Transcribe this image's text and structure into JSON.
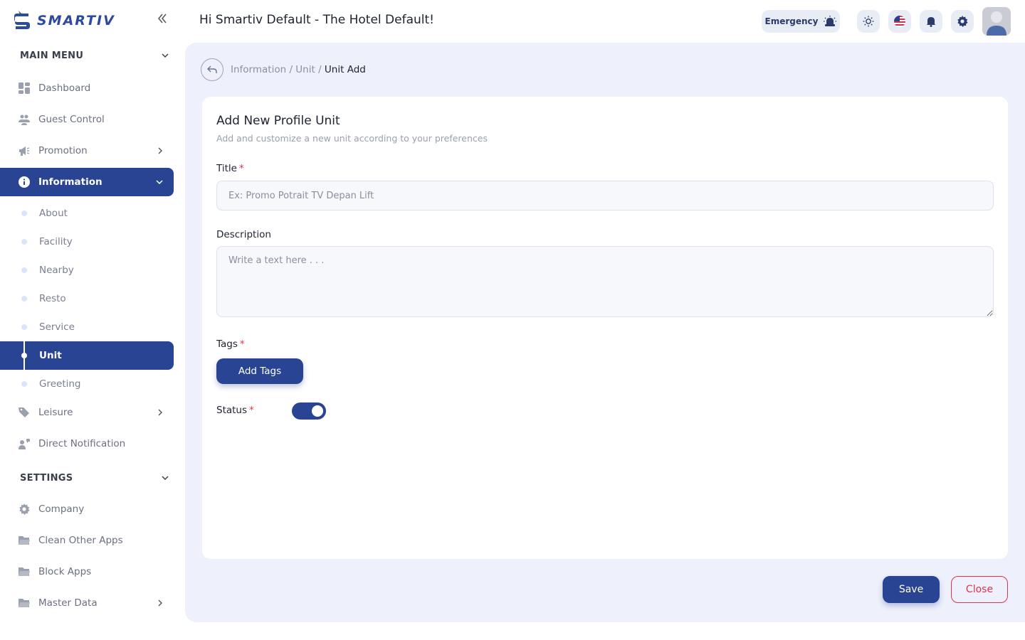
{
  "app": {
    "logo_text": "SMARTIV"
  },
  "header": {
    "greeting": "Hi Smartiv Default - The Hotel Default!",
    "emergency_label": "Emergency",
    "icons": [
      "sun-icon",
      "us-flag-icon",
      "bell-icon",
      "gear-icon",
      "user-avatar"
    ]
  },
  "sidebar": {
    "main_menu_label": "MAIN MENU",
    "settings_label": "SETTINGS",
    "items": [
      {
        "label": "Dashboard",
        "icon": "dashboard-icon"
      },
      {
        "label": "Guest Control",
        "icon": "users-icon"
      },
      {
        "label": "Promotion",
        "icon": "megaphone-icon",
        "has_children": true
      },
      {
        "label": "Information",
        "icon": "info-icon",
        "active": true,
        "expanded": true
      },
      {
        "label": "Leisure",
        "icon": "tag-icon",
        "has_children": true
      },
      {
        "label": "Direct Notification",
        "icon": "notification-icon"
      }
    ],
    "information_sub": [
      {
        "label": "About"
      },
      {
        "label": "Facility"
      },
      {
        "label": "Nearby"
      },
      {
        "label": "Resto"
      },
      {
        "label": "Service"
      },
      {
        "label": "Unit",
        "active": true
      },
      {
        "label": "Greeting"
      }
    ],
    "settings_items": [
      {
        "label": "Company",
        "icon": "gear-icon"
      },
      {
        "label": "Clean Other Apps",
        "icon": "folder-icon"
      },
      {
        "label": "Block Apps",
        "icon": "folder-icon"
      },
      {
        "label": "Master Data",
        "icon": "folder-icon",
        "has_children": true
      }
    ]
  },
  "breadcrumb": {
    "part1": "Information",
    "sep": " / ",
    "part2": "Unit",
    "current": "Unit Add"
  },
  "form": {
    "title": "Add New Profile Unit",
    "subtitle": "Add and customize a new unit according to your preferences",
    "title_label": "Title",
    "title_placeholder": "Ex: Promo Potrait TV Depan Lift",
    "title_value": "",
    "description_label": "Description",
    "description_placeholder": "Write a text here . . .",
    "description_value": "",
    "tags_label": "Tags",
    "add_tags_label": "Add Tags",
    "status_label": "Status",
    "status_on": true,
    "required_mark": "*"
  },
  "actions": {
    "save_label": "Save",
    "close_label": "Close"
  },
  "colors": {
    "primary": "#2a4494",
    "danger": "#e0334a",
    "bg": "#eef1fb"
  }
}
